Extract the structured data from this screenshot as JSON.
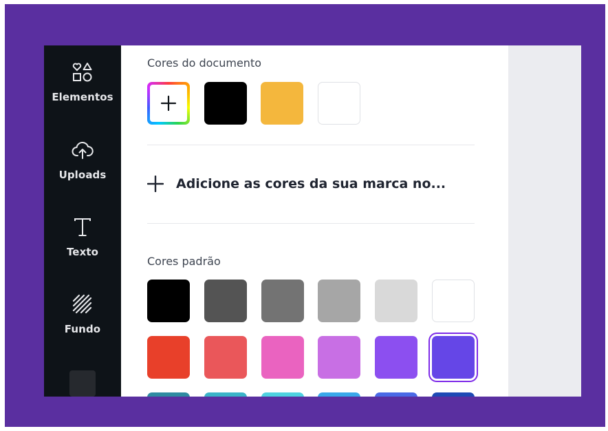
{
  "sidebar": {
    "items": [
      {
        "label": "Elementos",
        "icon": "shapes-icon"
      },
      {
        "label": "Uploads",
        "icon": "cloud-upload-icon"
      },
      {
        "label": "Texto",
        "icon": "text-t-icon"
      },
      {
        "label": "Fundo",
        "icon": "background-pattern-icon"
      }
    ]
  },
  "document_colors": {
    "title": "Cores do documento",
    "add_icon": "plus-icon",
    "colors": [
      "#000000",
      "#f4b73d",
      "#ffffff"
    ]
  },
  "brand": {
    "add_label": "Adicione as cores da sua marca no...",
    "icon": "plus-icon"
  },
  "default_colors": {
    "title": "Cores padrão",
    "row1": [
      "#000000",
      "#545454",
      "#737373",
      "#a6a6a6",
      "#d9d9d9",
      "#ffffff"
    ],
    "row2": [
      "#e8402a",
      "#ea575a",
      "#ea63c0",
      "#c86fe4",
      "#8c4ff0",
      "#6546e7"
    ],
    "row3": [
      "#2f8ba1",
      "#3bb4c8",
      "#4fd2e0",
      "#39a8ea",
      "#4a6ae6",
      "#1e4ab5"
    ],
    "selected": "#6546e7"
  },
  "colors": {
    "frame": "#5a2fa0",
    "sidebar_bg": "#0e1318",
    "selection_ring": "#7d2ae8"
  }
}
